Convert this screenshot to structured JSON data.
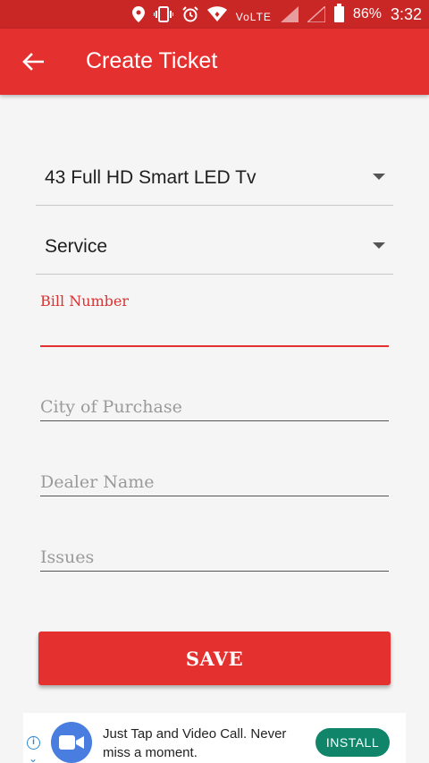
{
  "status_bar": {
    "network": "VoLTE",
    "battery": "86%",
    "time": "3:32",
    "icons": [
      "location-icon",
      "vibrate-icon",
      "alarm-icon",
      "wifi-icon",
      "signal-icon",
      "battery-icon"
    ]
  },
  "app_bar": {
    "title": "Create Ticket",
    "back_icon": "arrow-left-icon"
  },
  "form": {
    "product": {
      "value": "43  Full HD Smart LED Tv"
    },
    "request_type": {
      "value": "Service"
    },
    "bill_number": {
      "label": "Bill Number",
      "value": ""
    },
    "city_of_purchase": {
      "placeholder": "City of Purchase",
      "value": ""
    },
    "dealer_name": {
      "placeholder": "Dealer Name",
      "value": ""
    },
    "issues": {
      "placeholder": "Issues",
      "value": ""
    },
    "save_label": "SAVE"
  },
  "ad": {
    "text": "Just Tap and Video Call. Never miss a moment.",
    "install_label": "INSTALL"
  },
  "colors": {
    "status_bar": "#c92626",
    "app_bar": "#e53030",
    "accent": "#e53030",
    "install_button": "#11856a"
  }
}
